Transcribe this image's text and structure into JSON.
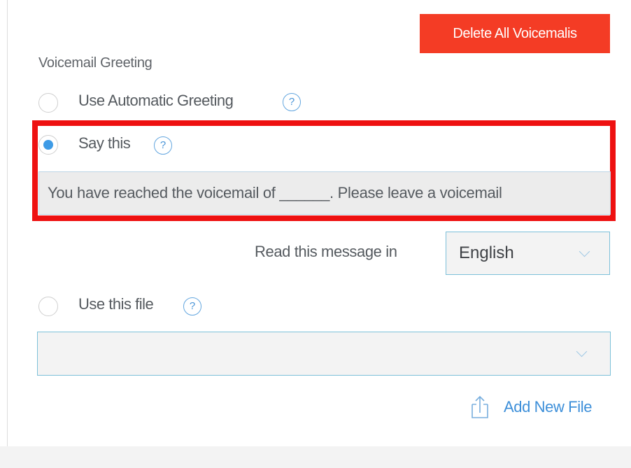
{
  "actions": {
    "delete_all_label": "Delete All Voicemalis"
  },
  "section": {
    "label": "Voicemail Greeting"
  },
  "options": {
    "automatic": {
      "label": "Use Automatic Greeting",
      "help_glyph": "?",
      "selected": false
    },
    "say_this": {
      "label": "Say this",
      "help_glyph": "?",
      "selected": true,
      "message_value": "You have reached the voicemail of ______. Please leave a voicemail"
    },
    "file": {
      "label": "Use this file",
      "help_glyph": "?",
      "selected": false,
      "selected_file": ""
    }
  },
  "language": {
    "label": "Read this message in",
    "selected": "English"
  },
  "add_file": {
    "label": "Add New File",
    "icon": "upload-icon"
  },
  "colors": {
    "delete_button": "#f43c25",
    "highlight": "#ee1111",
    "radio_selected": "#3e9be6",
    "link": "#3d8fd9"
  }
}
